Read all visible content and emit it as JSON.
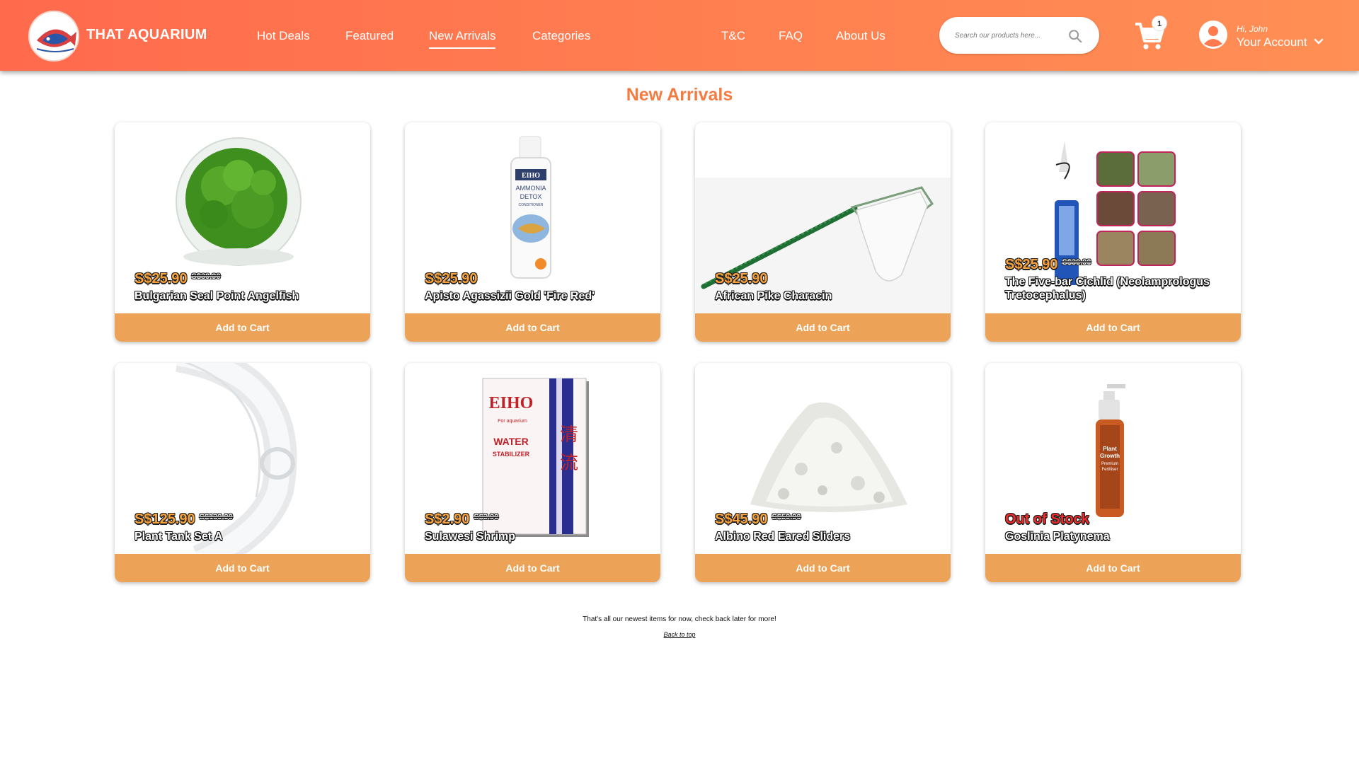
{
  "brand": {
    "name": "THAT AQUARIUM",
    "logo_icon": "angelfish-logo-icon"
  },
  "nav": {
    "left": [
      {
        "label": "Hot Deals"
      },
      {
        "label": "Featured"
      },
      {
        "label": "New Arrivals",
        "active": true
      },
      {
        "label": "Categories"
      }
    ],
    "right": [
      {
        "label": "T&C"
      },
      {
        "label": "FAQ"
      },
      {
        "label": "About Us"
      }
    ]
  },
  "search": {
    "placeholder": "Search our products here..."
  },
  "cart": {
    "count": "1"
  },
  "account": {
    "greeting": "Hi, John",
    "label": "Your Account"
  },
  "section_title": "New Arrivals",
  "products": [
    {
      "price": "S$25.90",
      "old_price": "S$39.90",
      "name": "Bulgarian Seal Point Angelfish",
      "cta": "Add to Cart"
    },
    {
      "price": "S$25.90",
      "old_price": "",
      "name": "Apisto Agassizii Gold 'Fire Red'",
      "cta": "Add to Cart"
    },
    {
      "price": "S$25.90",
      "old_price": "",
      "name": "African Pike Characin",
      "cta": "Add to Cart"
    },
    {
      "price": "S$25.90",
      "old_price": "S$39.90",
      "name": "The Five-bar Cichlid (Neolamprologus Tretocephalus)",
      "cta": "Add to Cart"
    },
    {
      "price": "S$125.90",
      "old_price": "S$139.90",
      "name": "Plant Tank Set A",
      "cta": "Add to Cart"
    },
    {
      "price": "S$2.90",
      "old_price": "S$3.90",
      "name": "Sulawesi Shrimp",
      "cta": "Add to Cart"
    },
    {
      "price": "S$45.90",
      "old_price": "S$59.90",
      "name": "Albino Red Eared Sliders",
      "cta": "Add to Cart"
    },
    {
      "price": "Out of Stock",
      "old_price": "",
      "name": "Goslinia Platynema",
      "cta": "Add to Cart"
    }
  ],
  "product_images": {
    "p0": {
      "bottle_label": ""
    },
    "p1": {
      "brand": "EIHO",
      "line1": "AMMONIA",
      "line2": "DETOX",
      "line3": "CONDITIONER"
    },
    "p5": {
      "brand": "EIHO",
      "sub": "For aquarium",
      "line1": "WATER",
      "line2": "STABILIZER"
    },
    "p7": {
      "line1": "Plant",
      "line2": "Growth",
      "line3": "Premium",
      "line4": "Fertiliser"
    }
  },
  "footer": {
    "message": "That's all our newest items for now, check back later for more!",
    "back_to_top": "Back to top"
  },
  "colors": {
    "header_start": "#ff6a4d",
    "header_end": "#ff8f55",
    "accent": "#f47c42",
    "button": "#eda357",
    "price": "#f9a23c",
    "out_of_stock": "#ee2a2a"
  }
}
